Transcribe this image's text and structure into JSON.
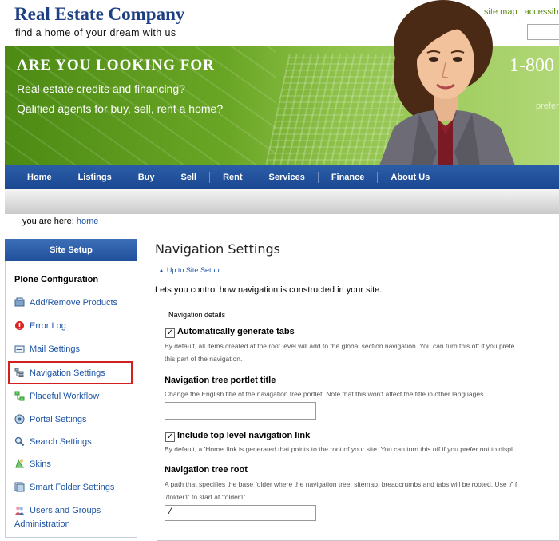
{
  "header": {
    "logo": "Real Estate Company",
    "tagline": "find a home of your dream with us",
    "top_links": [
      "site map",
      "accessib"
    ]
  },
  "banner": {
    "title": "ARE YOU LOOKING FOR",
    "line1": "Real estate credits and financing?",
    "line2": "Qalified agents for buy, sell, rent a home?",
    "phone": "1-800",
    "prefer": "prefer"
  },
  "nav": {
    "items": [
      "Home",
      "Listings",
      "Buy",
      "Sell",
      "Rent",
      "Services",
      "Finance",
      "About Us"
    ]
  },
  "breadcrumb": {
    "prefix": "you are here:",
    "home": "home"
  },
  "sidebar": {
    "title": "Site Setup",
    "subtitle": "Plone Configuration",
    "items": [
      {
        "label": "Add/Remove Products",
        "icon": "product-icon"
      },
      {
        "label": "Error Log",
        "icon": "error-icon"
      },
      {
        "label": "Mail Settings",
        "icon": "mail-icon"
      },
      {
        "label": "Navigation Settings",
        "icon": "navigation-icon",
        "selected": true
      },
      {
        "label": "Placeful Workflow",
        "icon": "workflow-icon"
      },
      {
        "label": "Portal Settings",
        "icon": "portal-icon"
      },
      {
        "label": "Search Settings",
        "icon": "search-icon"
      },
      {
        "label": "Skins",
        "icon": "skins-icon"
      },
      {
        "label": "Smart Folder Settings",
        "icon": "smart-folder-icon"
      },
      {
        "label": "Users and Groups",
        "label2": "Administration",
        "icon": "users-icon"
      }
    ]
  },
  "main": {
    "title": "Navigation Settings",
    "up_link": "Up to Site Setup",
    "description": "Lets you control how navigation is constructed in your site.",
    "legend": "Navigation details",
    "fields": {
      "auto_tabs": {
        "label": "Automatically generate tabs",
        "checked": true,
        "help1": "By default, all items created at the root level will add to the global section navigation. You can turn this off if you prefe",
        "help2": "this part of the navigation."
      },
      "tree_title": {
        "label": "Navigation tree portlet title",
        "help": "Change the English title of the navigation tree portlet. Note that this won't affect the title in other languages.",
        "value": ""
      },
      "top_level_link": {
        "label": "Include top level navigation link",
        "checked": true,
        "help": "By default, a 'Home' link is generated that points to the root of your site. You can turn this off if you prefer not to displ"
      },
      "tree_root": {
        "label": "Navigation tree root",
        "help1": "A path that specifies the base folder where the navigation tree, sitemap, breadcrumbs and tabs will be rooted. Use '/' f",
        "help2": "'/folder1' to start at 'folder1'.",
        "value": "/"
      }
    }
  },
  "colors": {
    "brand_blue": "#1e3f83",
    "nav_blue": "#204f9a",
    "banner_green": "#6aa625",
    "link_blue": "#1e55a5",
    "highlight_red": "#d21f1f"
  }
}
